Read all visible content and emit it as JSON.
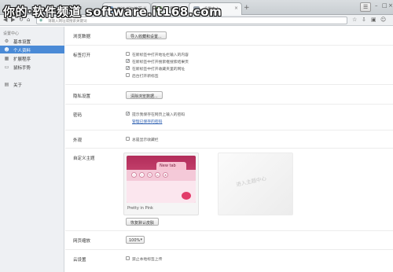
{
  "watermark": "你的·软件频道 software.it168.com",
  "tabs": [
    {
      "label": "简洁 新标签页"
    },
    {
      "label": "扩展中心"
    },
    {
      "label": "设置中心"
    }
  ],
  "address": {
    "text": "请输入网址或搜索关键词"
  },
  "sidebar": {
    "title": "设置中心",
    "items": [
      {
        "label": "基本设置",
        "icon": "gear-icon"
      },
      {
        "label": "个人资料",
        "icon": "user-icon"
      },
      {
        "label": "扩展程序",
        "icon": "puzzle-icon"
      },
      {
        "label": "鼠标手势",
        "icon": "mouse-icon"
      },
      {
        "label": "关于",
        "icon": "info-icon"
      }
    ]
  },
  "content": {
    "browse_data": {
      "label": "浏览数据",
      "button": "导入收藏和设置..."
    },
    "tabs_open": {
      "label": "标签打开",
      "options": [
        {
          "text": "在新标签中打开地址栏输入的内容",
          "checked": false
        },
        {
          "text": "在新标签中打开搜索框搜索结果页",
          "checked": true
        },
        {
          "text": "在新标签中打开收藏夹里的网址",
          "checked": true
        },
        {
          "text": "后台打开新标签",
          "checked": false
        }
      ]
    },
    "privacy": {
      "label": "隐私设置",
      "button": "清除浏览数据..."
    },
    "password": {
      "label": "密码",
      "option": "提示我保存在网页上输入的密码",
      "checked": true,
      "link": "管理已保存的密码"
    },
    "appearance": {
      "label": "外观",
      "option": "总是显示收藏栏",
      "checked": false
    },
    "theme": {
      "label": "自定义主题",
      "preview_tab": "New tab",
      "theme_name": "Pretty in Pink",
      "add_text": "进入主题中心",
      "restore_button": "恢复默认皮肤"
    },
    "zoom": {
      "label": "网页缩放",
      "value": "100%"
    },
    "cloud": {
      "label": "云设置",
      "option": "禁止本地标签上传",
      "checked": false
    }
  }
}
